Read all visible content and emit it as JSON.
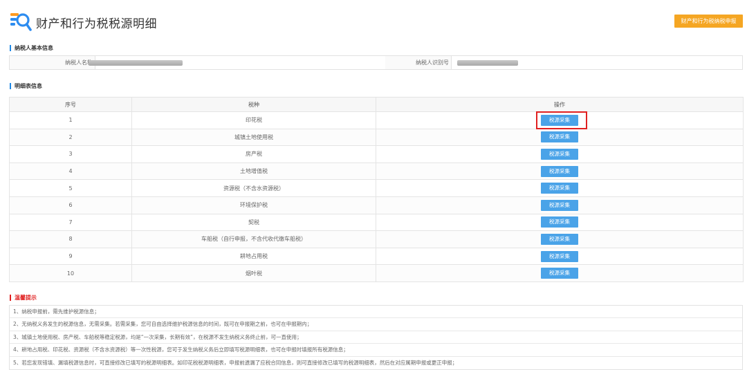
{
  "header": {
    "title": "财产和行为税税源明细",
    "icon": "search-document-icon",
    "declare_button": "财产和行为税纳税申报",
    "accent": "#f5a623"
  },
  "basic_info": {
    "section_title": "纳税人基本信息",
    "name_label": "纳税人名称",
    "id_label": "纳税人识别号"
  },
  "detail": {
    "section_title": "明细表信息",
    "columns": [
      "序号",
      "税种",
      "操作"
    ],
    "rows": [
      {
        "no": "1",
        "tax": "印花税",
        "action": "税源采集"
      },
      {
        "no": "2",
        "tax": "城镇土地使用税",
        "action": "税源采集"
      },
      {
        "no": "3",
        "tax": "房产税",
        "action": "税源采集"
      },
      {
        "no": "4",
        "tax": "土地增值税",
        "action": "税源采集"
      },
      {
        "no": "5",
        "tax": "资源税（不含水资源税）",
        "action": "税源采集"
      },
      {
        "no": "6",
        "tax": "环境保护税",
        "action": "税源采集"
      },
      {
        "no": "7",
        "tax": "契税",
        "action": "税源采集"
      },
      {
        "no": "8",
        "tax": "车船税（自行申报，不含代收代缴车船税）",
        "action": "税源采集"
      },
      {
        "no": "9",
        "tax": "耕地占用税",
        "action": "税源采集"
      },
      {
        "no": "10",
        "tax": "烟叶税",
        "action": "税源采集"
      }
    ]
  },
  "tips": {
    "section_title": "温馨提示",
    "items": [
      "1、纳税申报前，需先维护税源信息；",
      "2、无纳税义务发生的税源信息，无需采集。若需采集，您可自由选择维护税源信息的时间，既可在申报期之前，也可在申报期内；",
      "3、城镇土地使用税、房产税、车船税等稳定税源，均是“一次采集，长期有效”，在税源不发生纳税义务终止前，可一直使用；",
      "4、耕地占用税、印花税、资源税（不含水资源税）等一次性税源，您可于发生纳税义务后立即填写税源明细表，也可在申报时填报所有税源信息；",
      "5、若您发现错填、漏填税源信息时，可直接修改已填写的税源明细表。如印花税税源明细表，申报前遗漏了应税合同信息，则可直接修改已填写的税源明细表，然后在对应属期申报或更正申报；"
    ]
  }
}
